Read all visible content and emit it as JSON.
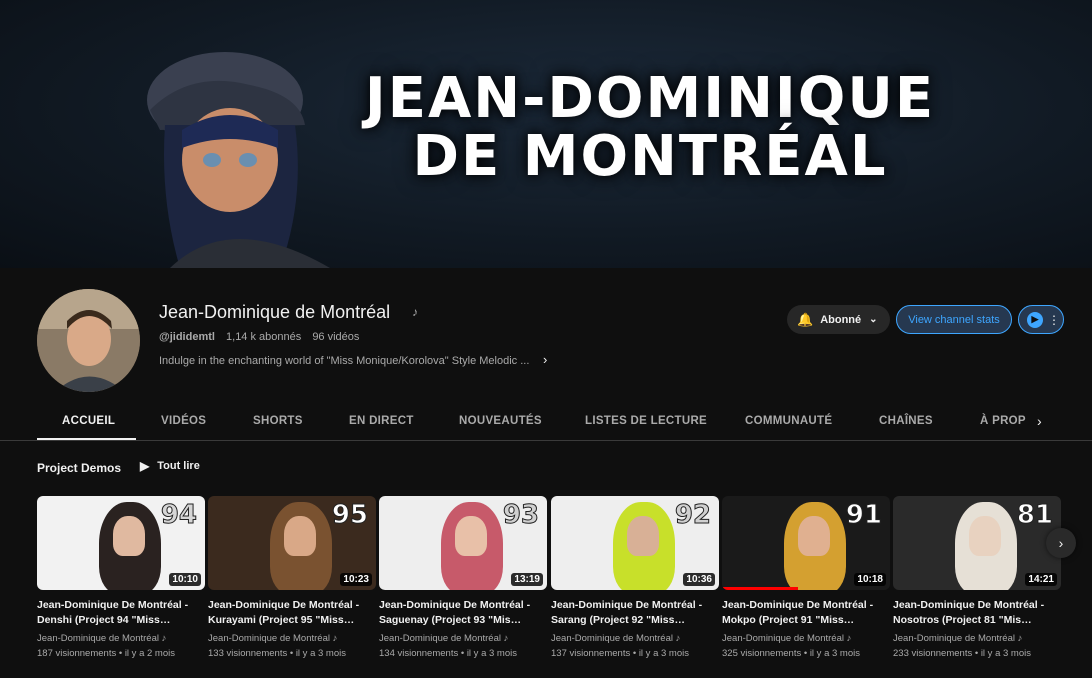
{
  "banner": {
    "title_line1": "JEAN-DOMINIQUE",
    "title_line2": "DE MONTRÉAL"
  },
  "channel": {
    "name": "Jean-Dominique de Montréal",
    "handle": "@jididemtl",
    "subscribers": "1,14 k abonnés",
    "videos": "96 vidéos",
    "description": "Indulge in the enchanting world of \"Miss Monique/Korolova\" Style Melodic ..."
  },
  "buttons": {
    "subscribed": "Abonné",
    "stats": "View channel stats"
  },
  "tabs": [
    "ACCUEIL",
    "VIDÉOS",
    "SHORTS",
    "EN DIRECT",
    "NOUVEAUTÉS",
    "LISTES DE LECTURE",
    "COMMUNAUTÉ",
    "CHAÎNES",
    "À PROP"
  ],
  "section": {
    "title": "Project Demos",
    "play_all": "Tout lire"
  },
  "videos": [
    {
      "number": "94",
      "duration": "10:10",
      "title": "Jean-Dominique De Montréal - Denshi (Project 94 \"Miss…",
      "channel": "Jean-Dominique de Montréal",
      "stats": "187 visionnements • il y a 2 mois",
      "bg": "#f2f2f2",
      "hair": "#2a2220",
      "skin": "#e0b9a0",
      "numcolor": "#d6d6d6"
    },
    {
      "number": "95",
      "duration": "10:23",
      "title": "Jean-Dominique De Montréal - Kurayami (Project 95 \"Miss…",
      "channel": "Jean-Dominique de Montréal",
      "stats": "133 visionnements • il y a 3 mois",
      "bg": "#3b2a1e",
      "hair": "#7a5230",
      "skin": "#d9a887",
      "numcolor": "#ffffff"
    },
    {
      "number": "93",
      "duration": "13:19",
      "title": "Jean-Dominique De Montréal - Saguenay (Project 93 \"Mis…",
      "channel": "Jean-Dominique de Montréal",
      "stats": "134 visionnements • il y a 3 mois",
      "bg": "#eeeeee",
      "hair": "#c75a6a",
      "skin": "#e8c0a8",
      "numcolor": "#d0d0d0"
    },
    {
      "number": "92",
      "duration": "10:36",
      "title": "Jean-Dominique De Montréal - Sarang (Project 92 \"Miss…",
      "channel": "Jean-Dominique de Montréal",
      "stats": "137 visionnements • il y a 3 mois",
      "bg": "#eeeeee",
      "hair": "#c8e02a",
      "skin": "#d8b096",
      "numcolor": "#d0d0d0"
    },
    {
      "number": "91",
      "duration": "10:18",
      "title": "Jean-Dominique De Montréal - Mokpo (Project 91 \"Miss…",
      "channel": "Jean-Dominique de Montréal",
      "stats": "325 visionnements • il y a 3 mois",
      "bg": "#1a1a1a",
      "hair": "#d4a030",
      "skin": "#e0b090",
      "numcolor": "#ffffff",
      "progress": 0.45
    },
    {
      "number": "81",
      "duration": "14:21",
      "title": "Jean-Dominique De Montréal - Nosotros (Project 81 \"Mis…",
      "channel": "Jean-Dominique de Montréal",
      "stats": "233 visionnements • il y a 3 mois",
      "bg": "#2a2a2a",
      "hair": "#e6e0d6",
      "skin": "#e8d2c0",
      "numcolor": "#ffffff"
    }
  ]
}
